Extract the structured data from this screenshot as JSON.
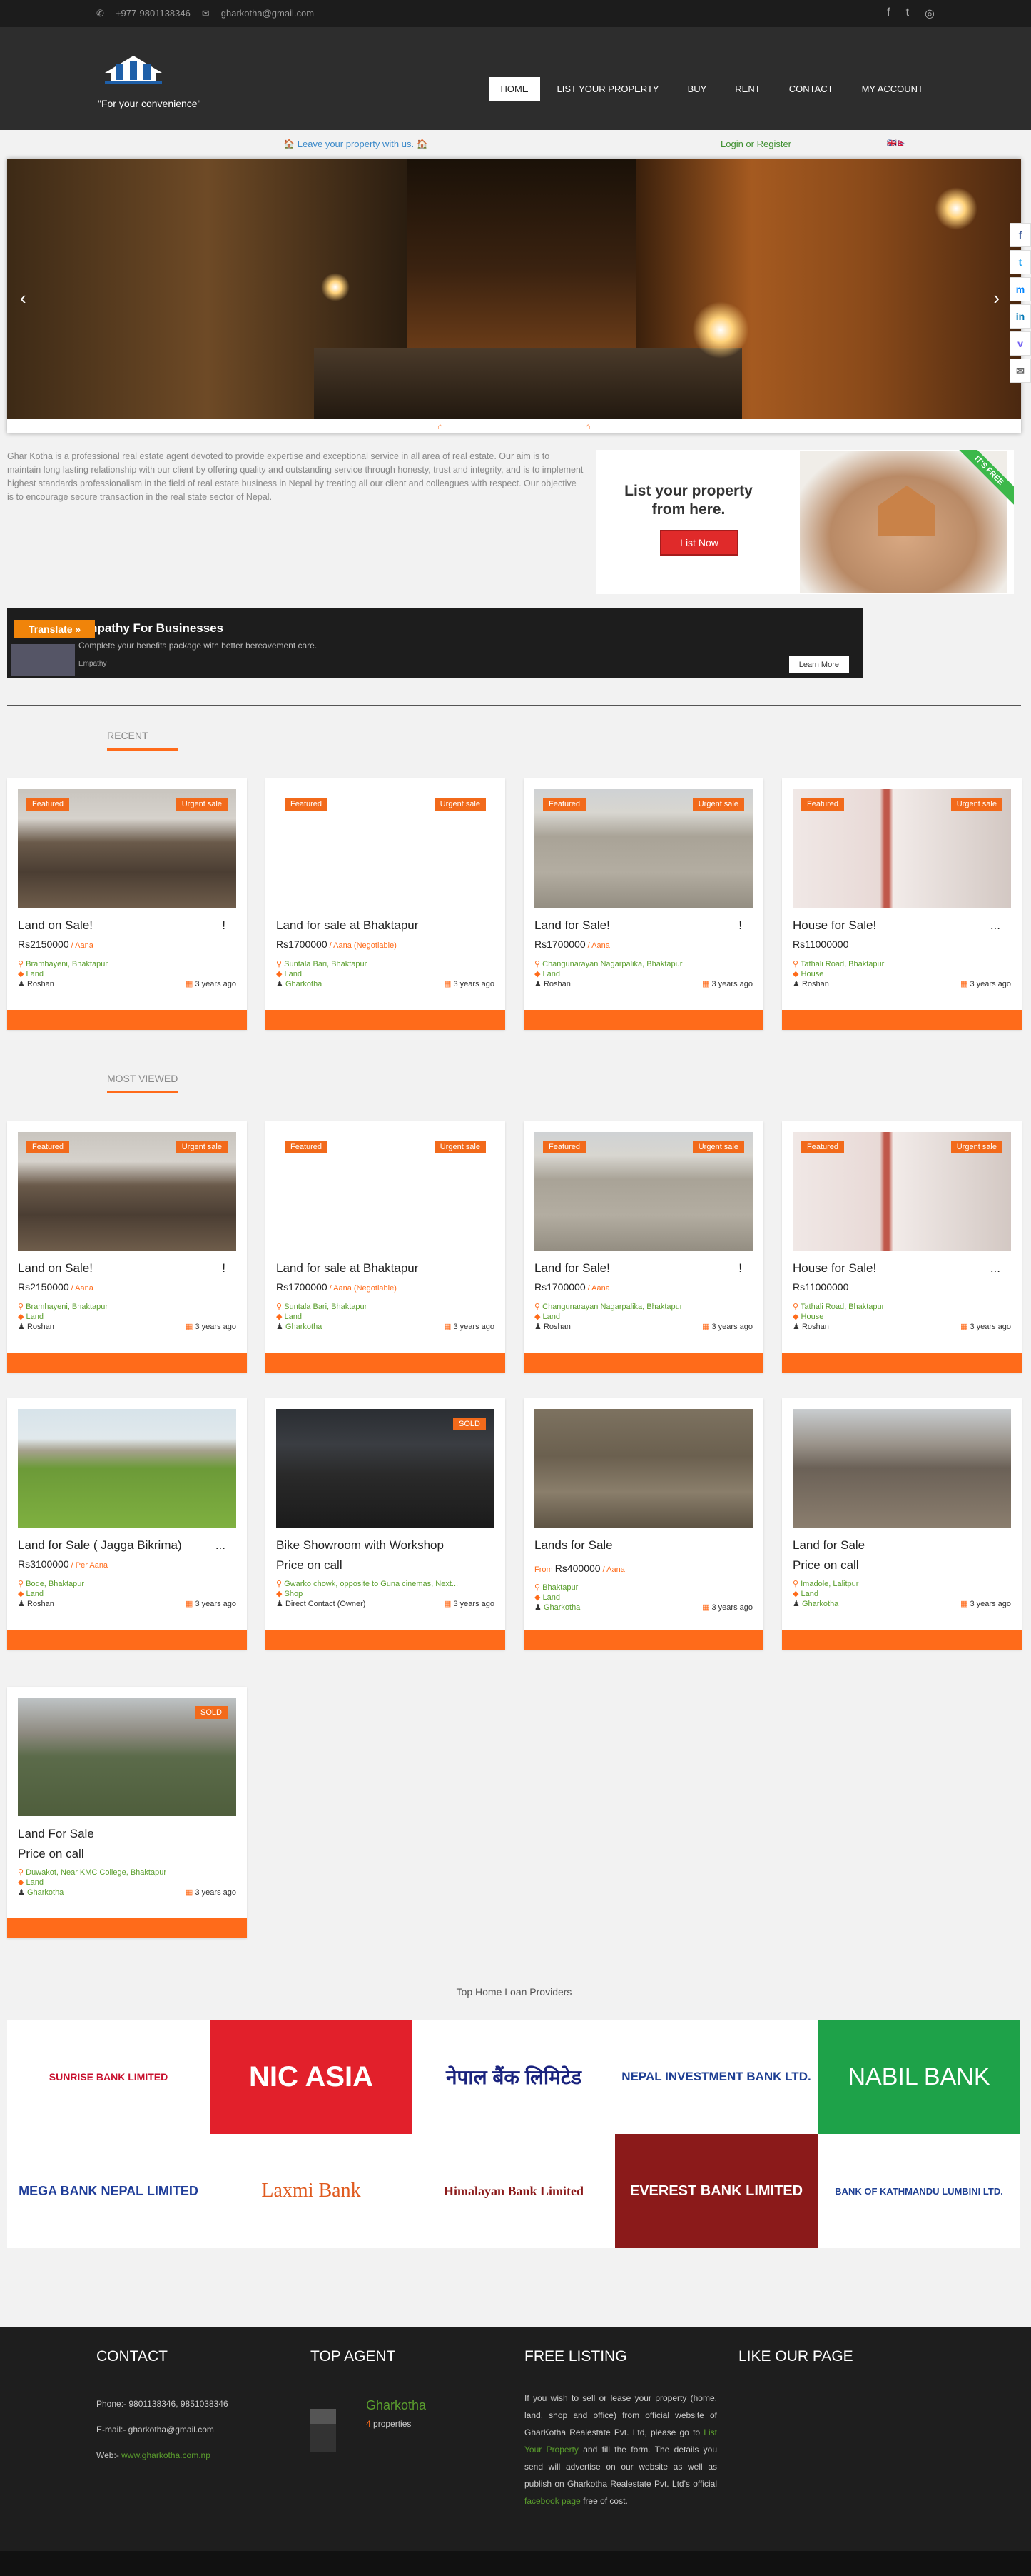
{
  "topbar": {
    "phone": "+977-9801138346",
    "email": "gharkotha@gmail.com"
  },
  "header": {
    "tagline": "\"For your convenience\"",
    "nav": [
      "HOME",
      "LIST YOUR PROPERTY",
      "BUY",
      "RENT",
      "CONTACT",
      "MY ACCOUNT"
    ]
  },
  "subbar": {
    "leave": "🏠 Leave your property with us. 🏠",
    "login": "Login or Register"
  },
  "about": "Ghar Kotha is a professional real estate agent devoted to provide expertise and exceptional service in all area of real estate. Our aim is to maintain long lasting relationship with our client by offering quality and outstanding service through honesty, trust and integrity, and is to implement highest standards professionalism in the field of real estate business in Nepal by treating all our client and colleagues with respect. Our objective is to encourage secure transaction in the real state sector of Nepal.",
  "listbox": {
    "title": "List your property from here.",
    "button": "List Now",
    "ribbon": "IT'S FREE"
  },
  "ad": {
    "title": "Empathy For Businesses",
    "desc": "Complete your benefits package with better bereavement care.",
    "brand": "Empathy",
    "cta": "Learn More",
    "translate": "Translate »"
  },
  "sections": {
    "recent": "RECENT",
    "most_viewed": "MOST VIEWED"
  },
  "cards": {
    "recent": [
      {
        "title": "Land on Sale!",
        "excl": "!",
        "price": "Rs2150000",
        "unit": " / Aana",
        "loc": "Bramhayeni, Bhaktapur",
        "type": "Land",
        "user": "Roshan",
        "ago": "3 years ago",
        "b1": "Featured",
        "b2": "Urgent sale"
      },
      {
        "title": "Land for sale at Bhaktapur",
        "excl": "",
        "price": "Rs1700000",
        "unit": " / Aana (Negotiable)",
        "loc": "Suntala Bari, Bhaktapur",
        "type": "Land",
        "user": "Gharkotha",
        "ago": "3 years ago",
        "b1": "Featured",
        "b2": "Urgent sale"
      },
      {
        "title": "Land for Sale!",
        "excl": "!",
        "price": "Rs1700000",
        "unit": " / Aana",
        "loc": "Changunarayan Nagarpalika, Bhaktapur",
        "type": "Land",
        "user": "Roshan",
        "ago": "3 years ago",
        "b1": "Featured",
        "b2": "Urgent sale"
      },
      {
        "title": "House for Sale!",
        "excl": "...",
        "price": "Rs11000000",
        "unit": "",
        "loc": "Tathali Road, Bhaktapur",
        "type": "House",
        "user": "Roshan",
        "ago": "3 years ago",
        "b1": "Featured",
        "b2": "Urgent sale"
      }
    ],
    "viewed": [
      {
        "title": "Land on Sale!",
        "excl": "!",
        "price": "Rs2150000",
        "unit": " / Aana",
        "loc": "Bramhayeni, Bhaktapur",
        "type": "Land",
        "user": "Roshan",
        "ago": "3 years ago",
        "b1": "Featured",
        "b2": "Urgent sale"
      },
      {
        "title": "Land for sale at Bhaktapur",
        "excl": "",
        "price": "Rs1700000",
        "unit": " / Aana (Negotiable)",
        "loc": "Suntala Bari, Bhaktapur",
        "type": "Land",
        "user": "Gharkotha",
        "ago": "3 years ago",
        "b1": "Featured",
        "b2": "Urgent sale"
      },
      {
        "title": "Land for Sale!",
        "excl": "!",
        "price": "Rs1700000",
        "unit": " / Aana",
        "loc": "Changunarayan Nagarpalika, Bhaktapur",
        "type": "Land",
        "user": "Roshan",
        "ago": "3 years ago",
        "b1": "Featured",
        "b2": "Urgent sale"
      },
      {
        "title": "House for Sale!",
        "excl": "...",
        "price": "Rs11000000",
        "unit": "",
        "loc": "Tathali Road, Bhaktapur",
        "type": "House",
        "user": "Roshan",
        "ago": "3 years ago",
        "b1": "Featured",
        "b2": "Urgent sale"
      },
      {
        "title": "Land for Sale ( Jagga Bikrima)",
        "excl": "...",
        "price": "Rs3100000",
        "unit": " / Per Aana",
        "loc": "Bode, Bhaktapur",
        "type": "Land",
        "user": "Roshan",
        "ago": "3 years ago",
        "b1": "",
        "b2": ""
      },
      {
        "title": "Bike Showroom with Workshop",
        "excl": "",
        "price": "Price on call",
        "unit": "",
        "loc": "Gwarko chowk, opposite to Guna cinemas, Next...",
        "type": "Shop",
        "user": "Direct Contact (Owner)",
        "ago": "3 years ago",
        "b1": "",
        "b2": "SOLD"
      },
      {
        "title": "Lands for Sale",
        "excl": "",
        "price": "Rs400000",
        "unit": " / Aana",
        "from": "From",
        "loc": "Bhaktapur",
        "type": "Land",
        "user": "Gharkotha",
        "ago": "3 years ago",
        "b1": "",
        "b2": ""
      },
      {
        "title": "Land for Sale",
        "excl": "",
        "price": "Price on call",
        "unit": "",
        "loc": "Imadole, Lalitpur",
        "type": "Land",
        "user": "Gharkotha",
        "ago": "3 years ago",
        "b1": "",
        "b2": ""
      },
      {
        "title": "Land For Sale",
        "excl": "",
        "price": "Price on call",
        "unit": "",
        "loc": "Duwakot, Near KMC College, Bhaktapur",
        "type": "Land",
        "user": "Gharkotha",
        "ago": "3 years ago",
        "b1": "",
        "b2": "SOLD"
      }
    ]
  },
  "loans": {
    "title": "Top Home Loan Providers",
    "banks": [
      "SUNRISE BANK LIMITED",
      "NIC ASIA",
      "नेपाल बैंक लिमिटेड",
      "NEPAL INVESTMENT BANK LTD.",
      "NABIL BANK",
      "MEGA BANK NEPAL LIMITED",
      "Laxmi Bank",
      "Himalayan Bank Limited",
      "EVEREST BANK LIMITED",
      "BANK OF KATHMANDU LUMBINI LTD."
    ]
  },
  "footer": {
    "contact_h": "CONTACT",
    "agent_h": "TOP AGENT",
    "free_h": "FREE LISTING",
    "like_h": "LIKE OUR PAGE",
    "phone": "Phone:- 9801138346, 9851038346",
    "email": "E-mail:- gharkotha@gmail.com",
    "web_label": "Web:-",
    "web": "www.gharkotha.com.np",
    "agent": "Gharkotha",
    "props_n": "4",
    "props": "properties",
    "free1": "If you wish to sell or lease your property (home, land, shop and office) from official website of GharKotha Realestate Pvt. Ltd, please go to",
    "free_link": "List Your Property",
    "free2": "and fill the form. The details you send will advertise on our website as well as publish on Gharkotha Realestate Pvt. Ltd's official",
    "fb_link": "facebook page",
    "free3": "free of cost."
  },
  "colors": {
    "accent": "#ff6b1a",
    "dark": "#2d2d2d",
    "green": "#5a9e2d"
  }
}
